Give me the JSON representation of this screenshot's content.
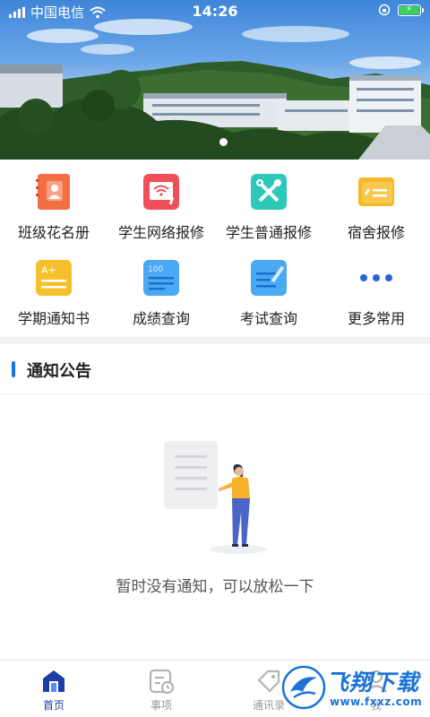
{
  "status_bar": {
    "carrier": "中国电信",
    "time": "14:26"
  },
  "banner": {
    "slide_count": 1,
    "active_slide": 1
  },
  "functions": [
    {
      "label": "班级花名册",
      "icon": "roster-icon",
      "color": "#f36d45"
    },
    {
      "label": "学生网络报修",
      "icon": "network-repair-icon",
      "color": "#f04f5a"
    },
    {
      "label": "学生普通报修",
      "icon": "tools-repair-icon",
      "color": "#2dc9b8"
    },
    {
      "label": "宿舍报修",
      "icon": "dorm-repair-icon",
      "color": "#f6b828"
    },
    {
      "label": "学期通知书",
      "icon": "report-card-icon",
      "color": "#f6c02c"
    },
    {
      "label": "成绩查询",
      "icon": "score-query-icon",
      "color": "#4aa9f2"
    },
    {
      "label": "考试查询",
      "icon": "exam-query-icon",
      "color": "#4aa9f2"
    },
    {
      "label": "更多常用",
      "icon": "more-icon",
      "color": "#2b63d9"
    }
  ],
  "notice": {
    "title": "通知公告",
    "empty_message": "暂时没有通知，可以放松一下"
  },
  "tabs": [
    {
      "label": "首页",
      "icon": "home-icon",
      "active": true
    },
    {
      "label": "事项",
      "icon": "schedule-icon",
      "active": false
    },
    {
      "label": "通讯录",
      "icon": "contacts-icon",
      "active": false
    },
    {
      "label": "我",
      "icon": "profile-icon",
      "active": false
    }
  ],
  "watermark": {
    "brand": "飞翔下载",
    "url": "www.fxxz.com"
  },
  "colors": {
    "accent": "#1a73e8",
    "active_tab": "#1a3ea3",
    "inactive_tab": "#999999"
  }
}
